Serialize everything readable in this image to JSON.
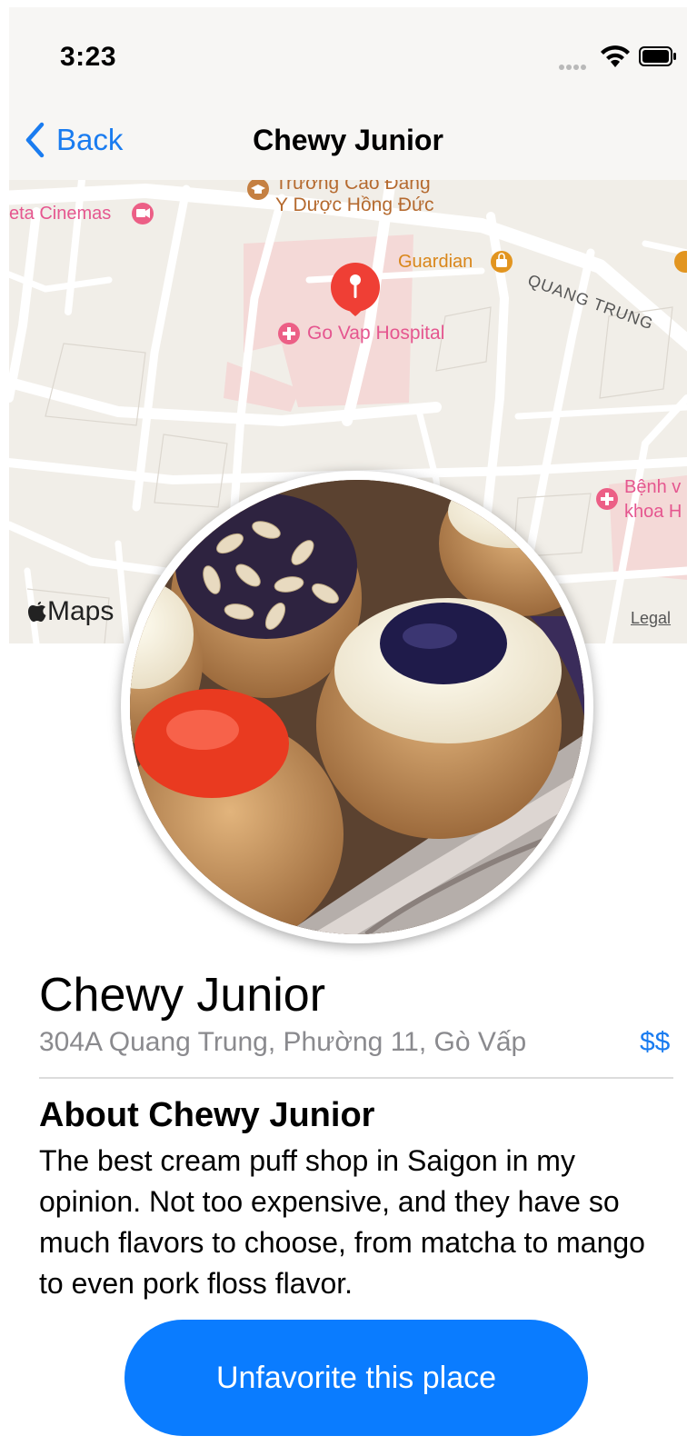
{
  "status_bar": {
    "time": "3:23"
  },
  "nav": {
    "back_label": "Back",
    "title": "Chewy Junior"
  },
  "map": {
    "labels": {
      "school_line1": "Trường Cao Đẳng",
      "school_line2": "Y Dược Hồng Đức",
      "cinema": "eta Cinemas",
      "guardian": "Guardian",
      "street": "QUANG TRUNG",
      "hospital": "Go Vap Hospital",
      "benh_line1": "Bệnh v",
      "benh_line2": "khoa H"
    },
    "brand": "Maps",
    "legal": "Legal",
    "colors": {
      "background": "#f1eee8",
      "hospital_area": "#f4d9d7",
      "pin": "#ef3f35",
      "poi_pink": "#ec5f86",
      "poi_orange": "#e29520",
      "school_brown": "#c58042"
    }
  },
  "place": {
    "name": "Chewy Junior",
    "address": "304A Quang Trung, Phường 11, Gò Vấp",
    "price": "$$"
  },
  "about": {
    "title": "About Chewy Junior",
    "body": "The best cream puff shop in Saigon in my opinion. Not too expensive, and they have so much flavors to choose, from matcha to mango to even pork floss flavor."
  },
  "action": {
    "label": "Unfavorite this place"
  },
  "colors": {
    "accent": "#1a7cf0",
    "button": "#0a7cff"
  }
}
